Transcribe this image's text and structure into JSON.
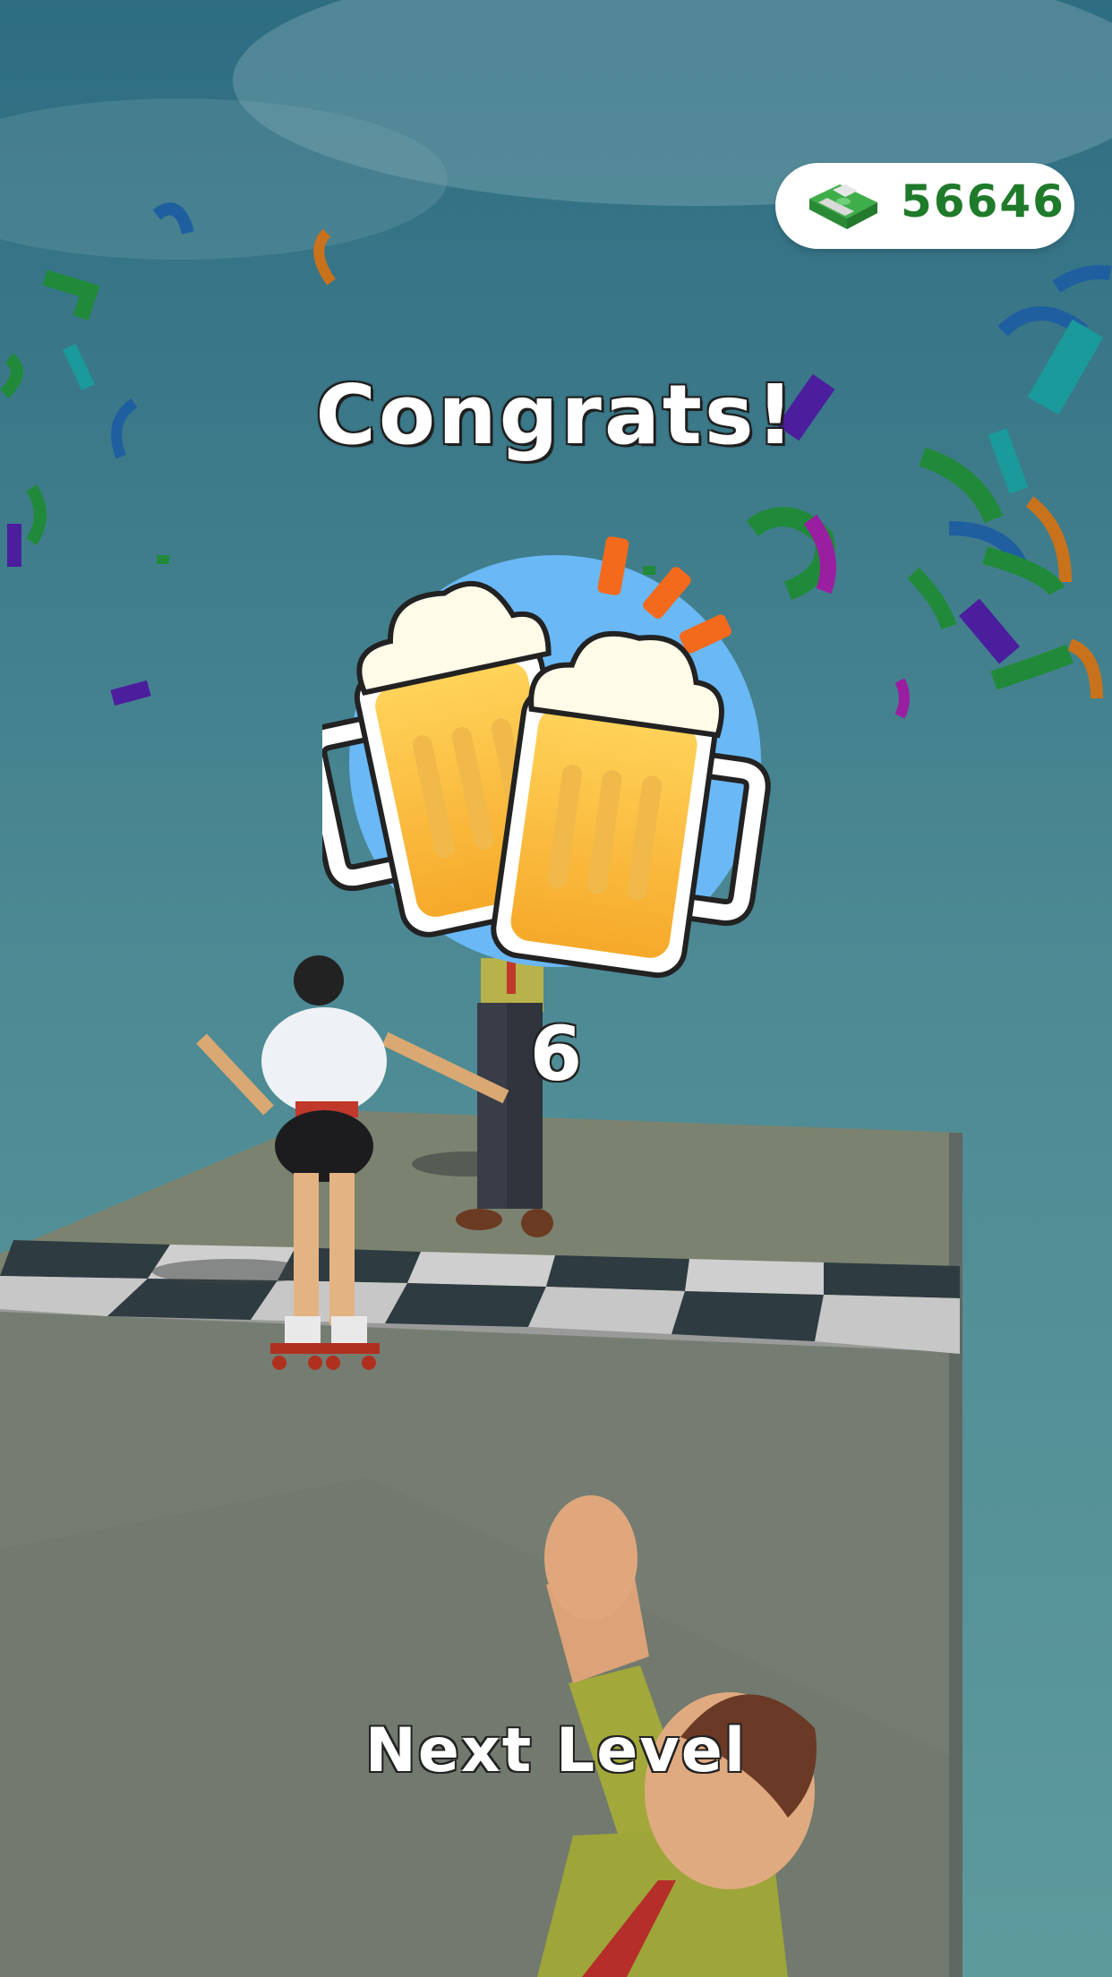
{
  "currency": {
    "icon": "cash-stack-icon",
    "amount": "56646",
    "color": "#1f7a2a"
  },
  "result": {
    "title": "Congrats!",
    "badge_icon": "beer-mugs-cheers-icon",
    "badge_bg": "#6ab8f5",
    "level_number": "6"
  },
  "actions": {
    "next_label": "Next Level"
  },
  "scene": {
    "sky_color": "#4f8c96",
    "ground_color": "#7b8477",
    "characters": [
      "skater-girl",
      "man-in-suit",
      "cheering-man"
    ]
  }
}
